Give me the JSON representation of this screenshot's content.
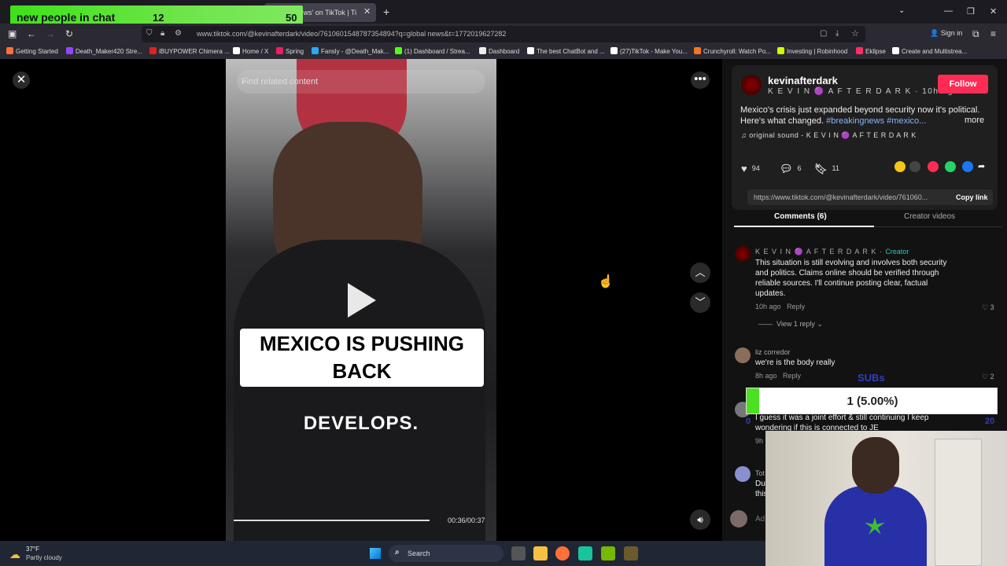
{
  "browser": {
    "active_tab_title": "al news' on TikTok | Ti",
    "url": "www.tiktok.com/@kevinafterdark/video/7610601548787354894?q=global news&t=1772019627282",
    "sign_in": "Sign in",
    "bookmarks": [
      {
        "label": "Getting Started",
        "color": "#ff7139"
      },
      {
        "label": "Death_Maker420 Stre...",
        "color": "#9146ff"
      },
      {
        "label": "iBUYPOWER Chimera ...",
        "color": "#d22"
      },
      {
        "label": "Home / X",
        "color": "#fff"
      },
      {
        "label": "Spring",
        "color": "#e91e63"
      },
      {
        "label": "Fansly - @Death_Mak...",
        "color": "#29a8f5"
      },
      {
        "label": "(1) Dashboard / Strea...",
        "color": "#53fc18"
      },
      {
        "label": "Dashboard",
        "color": "#eee"
      },
      {
        "label": "The best ChatBot and ...",
        "color": "#fff"
      },
      {
        "label": "(27)TikTok - Make You...",
        "color": "#fff"
      },
      {
        "label": "Crunchyroll: Watch Po...",
        "color": "#f47521"
      },
      {
        "label": "Investing | Robinhood",
        "color": "#ccff00"
      },
      {
        "label": "Eklipse",
        "color": "#ff2e63"
      },
      {
        "label": "Create and Multistrea...",
        "color": "#fff"
      }
    ]
  },
  "chat_overlay": {
    "label": "new people in chat",
    "count": "12",
    "goal": "50"
  },
  "video": {
    "search_placeholder": "Find related content",
    "caption_line1": "MEXICO IS PUSHING",
    "caption_line2": "BACK",
    "caption_bottom": "DEVELOPS.",
    "time": "00:36/00:37",
    "progress": 0.97
  },
  "post": {
    "username": "kevinafterdark",
    "nickname": "K E V I N 🟣 A F T E R D A R K",
    "posted": "10h ago",
    "follow": "Follow",
    "description": "Mexico's crisis just expanded beyond security now it's political. Here's what changed.",
    "hashtags": "#breakingnews #mexico...",
    "more": "more",
    "sound": "original sound - K E V I N 🟣 A F T E R D A R K",
    "likes": "94",
    "comments": "6",
    "saves": "11",
    "link": "https://www.tiktok.com/@kevinafterdark/video/761060...",
    "copy_link": "Copy link"
  },
  "tabs": {
    "comments": "Comments (6)",
    "creator": "Creator videos"
  },
  "comments": [
    {
      "name": "K E V I N 🟣 A F T E R D A R K",
      "creator_tag": "Creator",
      "text": "This situation is still evolving and involves both security and politics. Claims online should be verified through reliable sources. I'll continue posting clear, factual updates.",
      "time": "10h ago",
      "reply": "Reply",
      "likes": "3",
      "view_replies": "View 1 reply"
    },
    {
      "name": "liz corredor",
      "text": "we're is the body really",
      "time": "8h ago",
      "reply": "Reply",
      "likes": "2"
    },
    {
      "name": "",
      "text": "I guess it was a joint effort & still continuing I keep wondering if this is connected to JE",
      "time": "9h"
    },
    {
      "name": "Tot",
      "text": "Du this"
    }
  ],
  "comment_input_placeholder": "Ad",
  "sub_goal": {
    "label": "SUBs",
    "text": "1 (5.00%)",
    "fraction": 0.05,
    "min": "0",
    "max": "20"
  },
  "taskbar": {
    "temp": "37°F",
    "weather": "Partly cloudy",
    "search": "Search"
  }
}
